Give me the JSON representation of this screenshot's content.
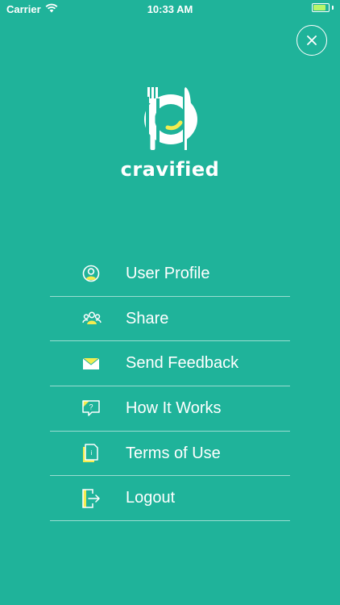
{
  "status_bar": {
    "carrier": "Carrier",
    "time": "10:33 AM",
    "battery_level": 0.85
  },
  "app": {
    "brand_name": "cravified",
    "colors": {
      "background": "#1fb39a",
      "accent": "#f3ec4f"
    }
  },
  "close_button": {
    "icon": "close-icon",
    "label": "×"
  },
  "menu": {
    "items": [
      {
        "label": "User Profile",
        "icon": "user-profile-icon"
      },
      {
        "label": "Share",
        "icon": "share-icon"
      },
      {
        "label": "Send Feedback",
        "icon": "envelope-icon"
      },
      {
        "label": "How It Works",
        "icon": "help-icon"
      },
      {
        "label": "Terms of Use",
        "icon": "document-icon"
      },
      {
        "label": "Logout",
        "icon": "logout-icon"
      }
    ]
  }
}
